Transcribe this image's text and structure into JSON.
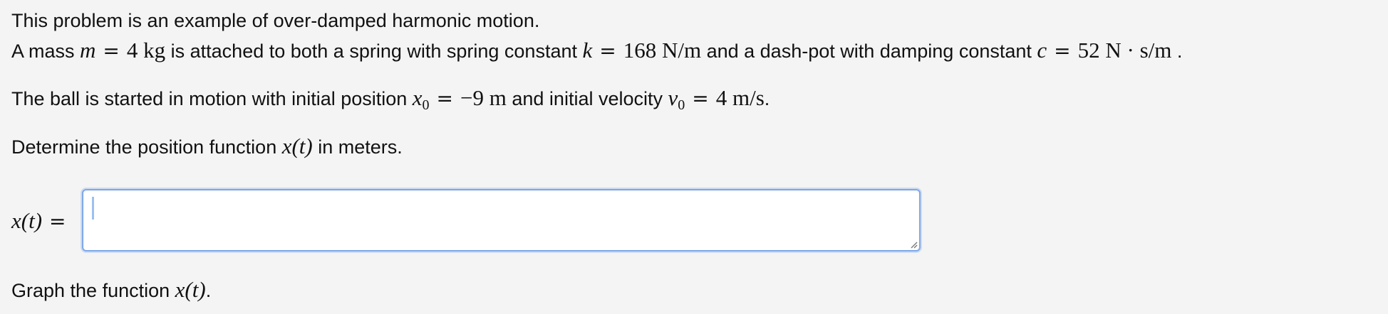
{
  "problem": {
    "intro": "This problem is an example of over-damped harmonic motion.",
    "line2": {
      "prefix": "A mass ",
      "mass_var": "m",
      "mass_value": "4 kg",
      "mid1": " is attached to both a spring with spring constant ",
      "k_var": "k",
      "k_value": "168 N/m",
      "mid2": " and a dash-pot with damping constant ",
      "c_var": "c",
      "c_value": "52 N · s/m",
      "suffix": " ."
    },
    "line3": {
      "prefix": "The ball is started in motion with initial position ",
      "x0_var": "x",
      "x0_sub": "0",
      "x0_value": "−9 m",
      "mid": " and initial velocity ",
      "v0_var": "v",
      "v0_sub": "0",
      "v0_value": "4 m/s",
      "suffix": "."
    },
    "line4": {
      "prefix": "Determine the position function ",
      "func": "x(t)",
      "suffix": " in meters."
    },
    "line6": {
      "prefix": "Graph the function ",
      "func": "x(t)",
      "suffix": "."
    }
  },
  "answer": {
    "label": "x(t)",
    "equals": "=",
    "value": "",
    "placeholder": ""
  },
  "colors": {
    "background": "#f4f4f4",
    "input_border": "#7fa9e6",
    "caret": "#9cc0f0"
  }
}
